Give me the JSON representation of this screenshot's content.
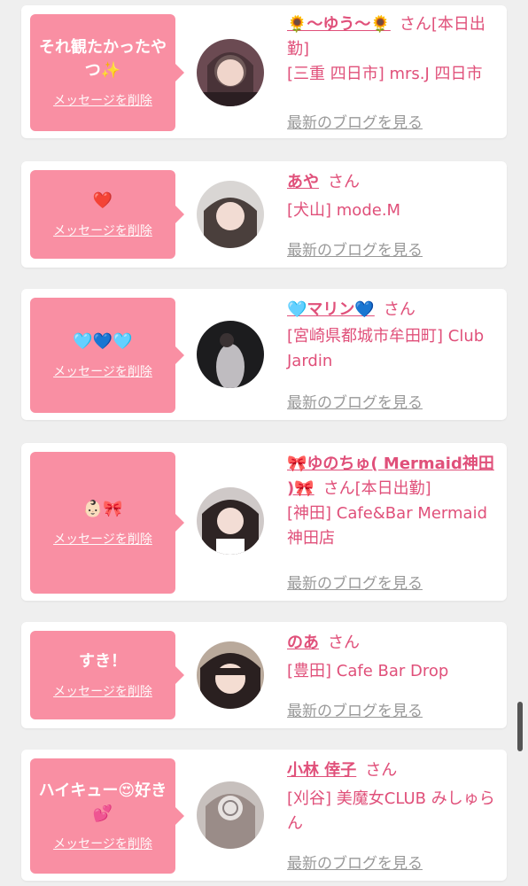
{
  "delete_label": "メッセージを削除",
  "blog_label": "最新のブログを見る",
  "san": "さん",
  "cards": [
    {
      "message": "それ観たかったやつ✨",
      "name": "🌻〜ゆう〜🌻",
      "status": "[本日出勤]",
      "shop": "[三重 四日市] mrs.J 四日市"
    },
    {
      "message": "❤️",
      "name": "あや",
      "status": "",
      "shop": "[犬山] mode.M"
    },
    {
      "message": "🩵💙🩵",
      "name": "🩵マリン💙",
      "status": "",
      "shop": "[宮崎県都城市牟田町] Club Jardin"
    },
    {
      "message": "👶🏻🎀",
      "name": "🎀ゆのちゅ( Mermaid神田 )🎀",
      "status": "[本日出勤]",
      "shop": "[神田] Cafe&Bar Mermaid 神田店"
    },
    {
      "message": "すき！",
      "name": "のあ",
      "status": "",
      "shop": "[豊田] Cafe Bar Drop"
    },
    {
      "message": "ハイキュー😍好き💕",
      "name": "小林 倖子",
      "status": "",
      "shop": "[刈谷] 美魔女CLUB みしゅらん"
    }
  ]
}
